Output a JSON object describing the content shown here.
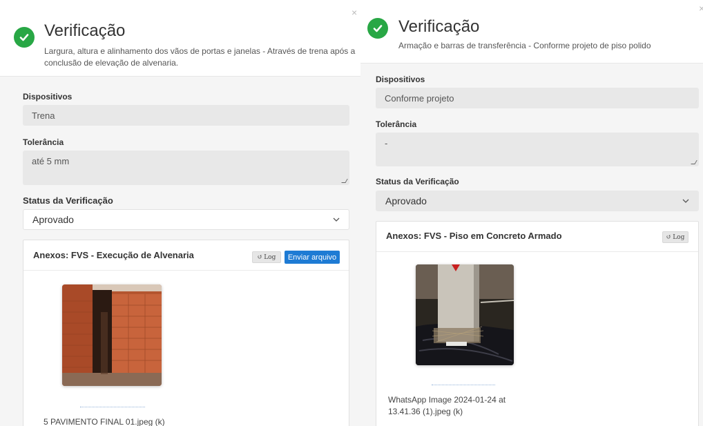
{
  "left": {
    "title": "Verificação",
    "description": "Largura, altura e alinhamento dos vãos de portas e janelas - Através de trena após a conclusão de elevação de alvenaria.",
    "close_glyph": "×",
    "dispositivos_label": "Dispositivos",
    "dispositivos_value": "Trena",
    "tolerancia_label": "Tolerância",
    "tolerancia_value": "até 5 mm",
    "status_label": "Status da Verificação",
    "status_value": "Aprovado",
    "attachments": {
      "title": "Anexos: FVS - Execução de Alvenaria",
      "log_label": "Log",
      "send_label": "Enviar arquivo",
      "file_name": "5 PAVIMENTO FINAL 01.jpeg (k)"
    }
  },
  "right": {
    "title": "Verificação",
    "description": "Armação e barras de transferência - Conforme projeto de piso polido",
    "close_glyph": "×",
    "dispositivos_label": "Dispositivos",
    "dispositivos_value": "Conforme projeto",
    "tolerancia_label": "Tolerância",
    "tolerancia_value": "-",
    "status_label": "Status da Verificação",
    "status_value": "Aprovado",
    "attachments": {
      "title": "Anexos: FVS - Piso em Concreto Armado",
      "log_label": "Log",
      "file_name": "WhatsApp Image 2024-01-24 at 13.41.36 (1).jpeg (k)"
    }
  },
  "icons": {
    "check": "check-circle-icon",
    "close": "close-icon",
    "history": "history-icon",
    "chevron": "chevron-down-icon"
  },
  "colors": {
    "success": "#28a745",
    "primary": "#1e7bd4"
  }
}
